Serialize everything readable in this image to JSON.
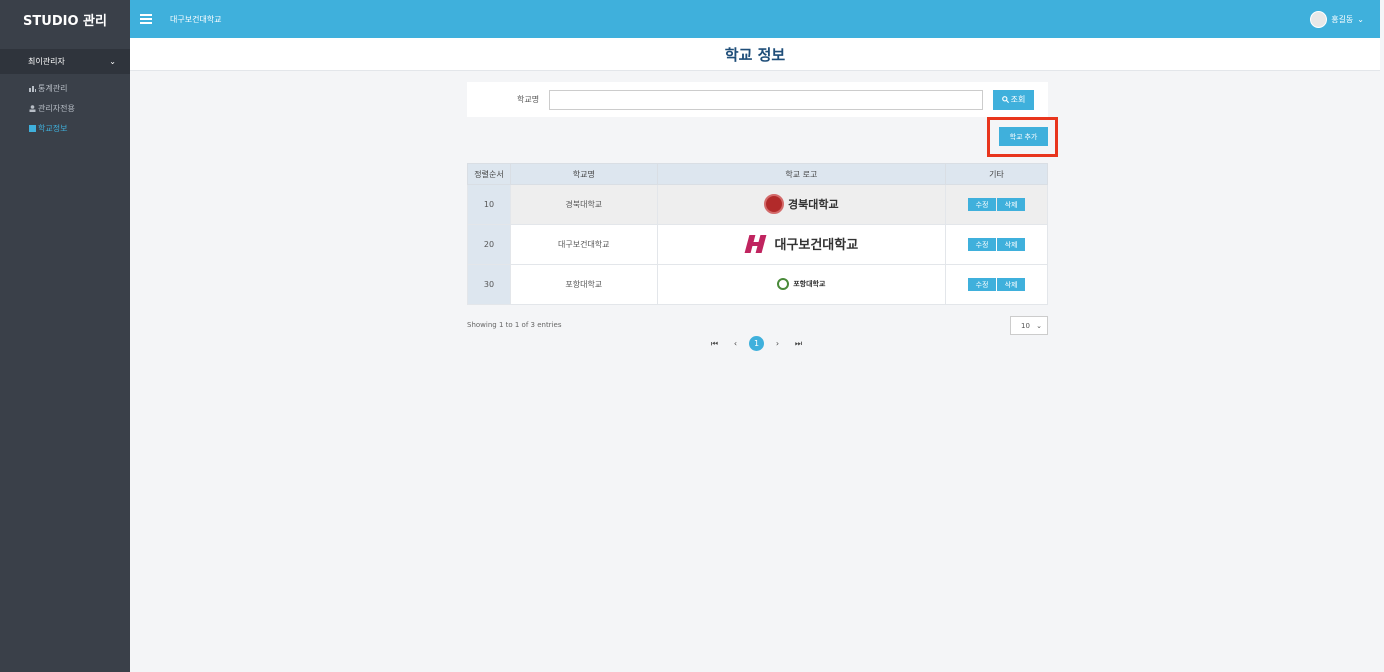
{
  "sidebar": {
    "brand": "STUDIO 관리",
    "group_label": "최이관리자",
    "group_chevron": "⌄",
    "items": [
      {
        "label": "통계관리",
        "icon": "chart-icon"
      },
      {
        "label": "관리자전용",
        "icon": "user-icon"
      },
      {
        "label": "학교정보",
        "icon": "school-icon",
        "active": true
      }
    ]
  },
  "topbar": {
    "school_name": "대구보건대학교",
    "user_name": "홍길동",
    "user_chevron": "⌄"
  },
  "page": {
    "title": "학교 정보"
  },
  "search": {
    "label": "학교명",
    "value": "",
    "button_label": "조회"
  },
  "actions": {
    "add_label": "학교 추가"
  },
  "table": {
    "headers": [
      "정렬순서",
      "학교명",
      "학교 로고",
      "기타"
    ],
    "rows": [
      {
        "order": "10",
        "name": "경북대학교",
        "logo_text": "경북대학교",
        "edit": "수정",
        "delete": "삭제"
      },
      {
        "order": "20",
        "name": "대구보건대학교",
        "logo_text": "대구보건대학교",
        "edit": "수정",
        "delete": "삭제"
      },
      {
        "order": "30",
        "name": "포항대학교",
        "logo_text": "포항대학교",
        "edit": "수정",
        "delete": "삭제"
      }
    ]
  },
  "footer": {
    "info": "Showing 1 to 1 of 3 entries",
    "page_size": "10",
    "pagination": {
      "first": "⏮",
      "prev": "‹",
      "current": "1",
      "next": "›",
      "last": "⏭"
    }
  },
  "colors": {
    "accent": "#3fb0dc",
    "sidebar": "#3a4049",
    "highlight": "#e8351d"
  }
}
